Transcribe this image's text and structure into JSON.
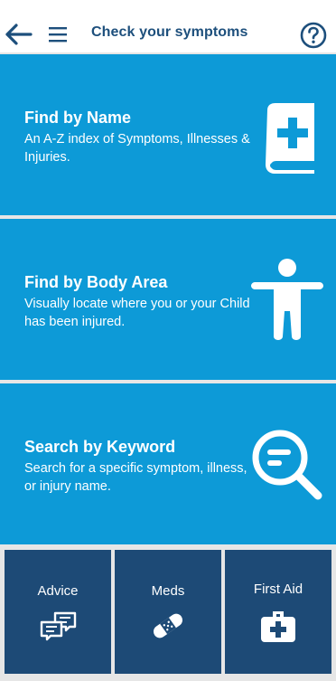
{
  "header": {
    "title": "Check your symptoms",
    "back_icon": "arrow-left-icon",
    "menu_icon": "hamburger-menu-icon",
    "help_icon": "help-circle-icon"
  },
  "cards": [
    {
      "title": "Find by Name",
      "desc": "An A-Z index of Symptoms, Illnesses & Injuries.",
      "icon": "medical-book-icon"
    },
    {
      "title": "Find by Body Area",
      "desc": "Visually locate where you or your Child has been injured.",
      "icon": "body-figure-icon"
    },
    {
      "title": "Search by Keyword",
      "desc": "Search for a specific symptom, illness, or injury name.",
      "icon": "magnifier-icon"
    }
  ],
  "tiles": [
    {
      "label": "Advice",
      "icon": "chat-bubbles-icon"
    },
    {
      "label": "Meds",
      "icon": "bandage-icon"
    },
    {
      "label": "First Aid",
      "icon": "first-aid-kit-icon"
    }
  ],
  "colors": {
    "header_text": "#1d4f7c",
    "card_bg": "#0d9ad7",
    "tile_bg": "#1d4a76",
    "page_bg": "#e6e6e6"
  }
}
